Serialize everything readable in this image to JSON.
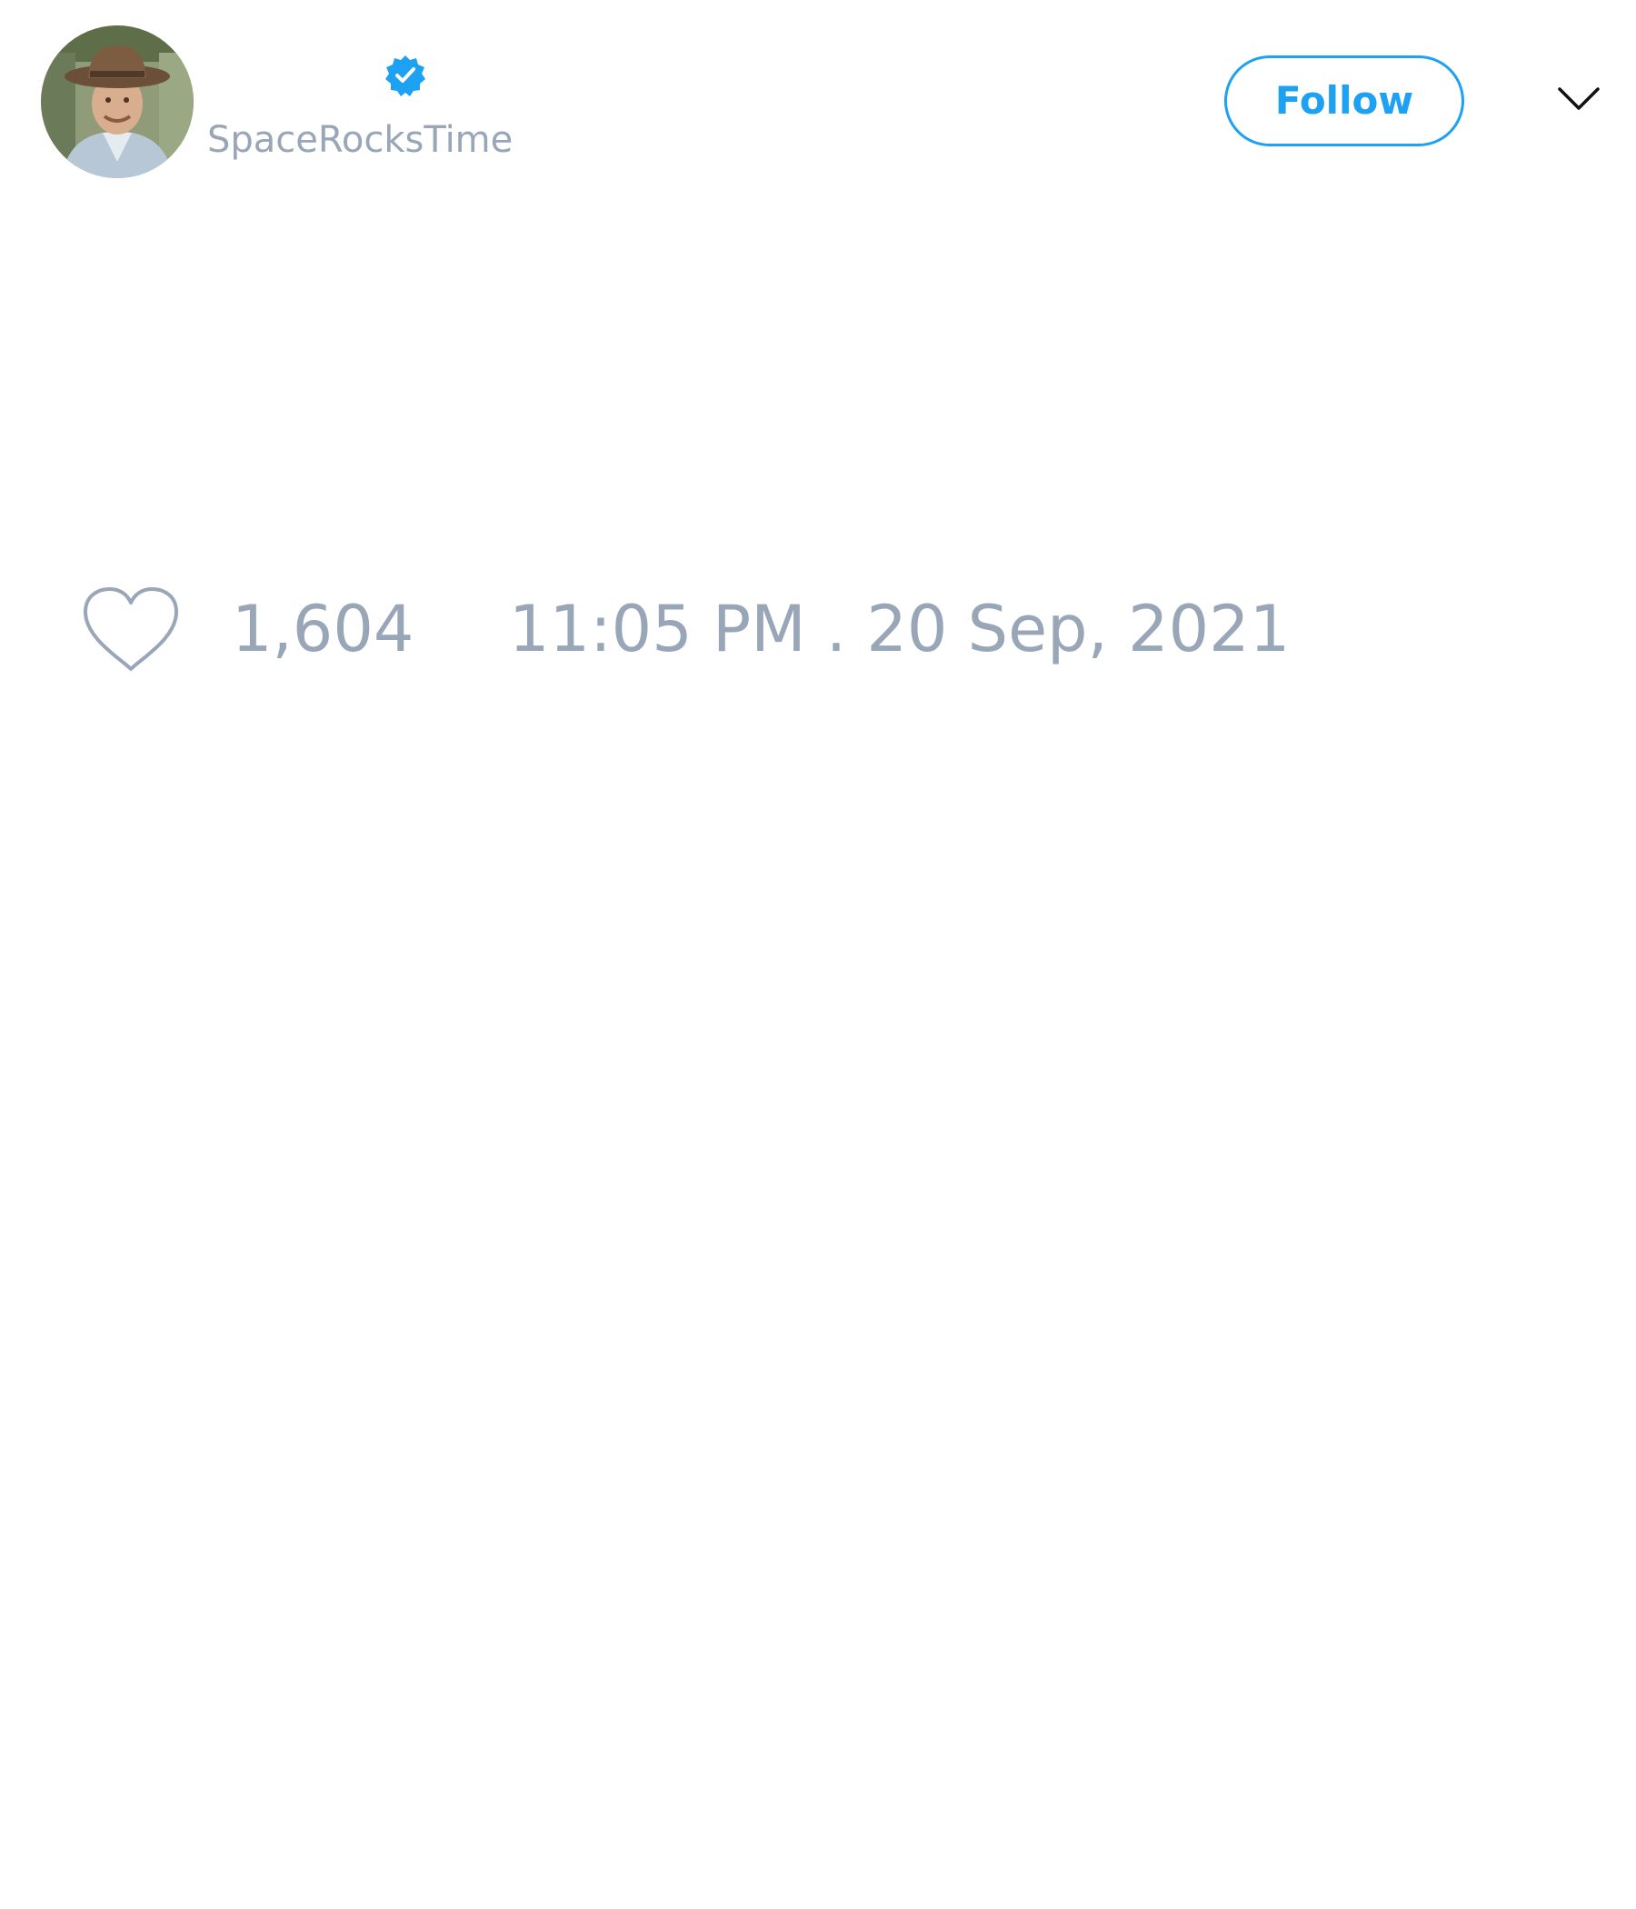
{
  "tweet": {
    "author": {
      "handle": "SpaceRocksTime",
      "verified": true,
      "avatar_icon": "user-avatar-photo"
    },
    "follow_label": "Follow",
    "likes": "1,604",
    "timestamp": "11:05 PM . 20 Sep, 2021"
  },
  "icons": {
    "verified": "verified-badge-icon",
    "more": "chevron-down-icon",
    "like": "heart-icon"
  },
  "colors": {
    "accent": "#1da1f2",
    "muted_text": "#98a6b8",
    "background": "#ffffff",
    "icon_dark": "#111111"
  }
}
